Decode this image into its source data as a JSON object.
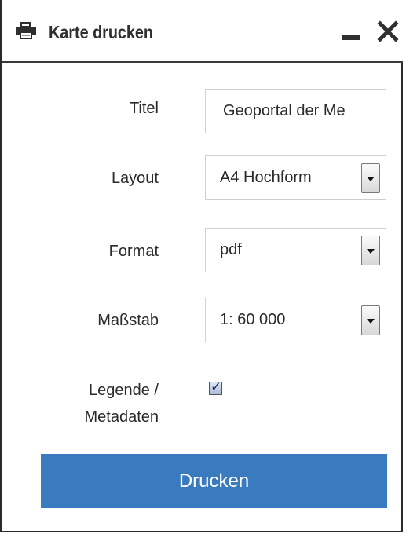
{
  "window": {
    "title": "Karte drucken",
    "icons": {
      "title_icon": "printer-icon",
      "minimize": "minimize-icon",
      "close": "close-icon"
    }
  },
  "form": {
    "title_label": "Titel",
    "title_value": "Geoportal der Me",
    "layout_label": "Layout",
    "layout_value": "A4 Hochform",
    "format_label": "Format",
    "format_value": "pdf",
    "scale_label": "Maßstab",
    "scale_value": "1: 60 000",
    "legend_label_line1": "Legende /",
    "legend_label_line2": "Metadaten",
    "legend_checked": true
  },
  "actions": {
    "print_label": "Drucken"
  },
  "colors": {
    "accent": "#3a7abf",
    "text": "#2a2a2a",
    "border": "#cfcfcf"
  }
}
